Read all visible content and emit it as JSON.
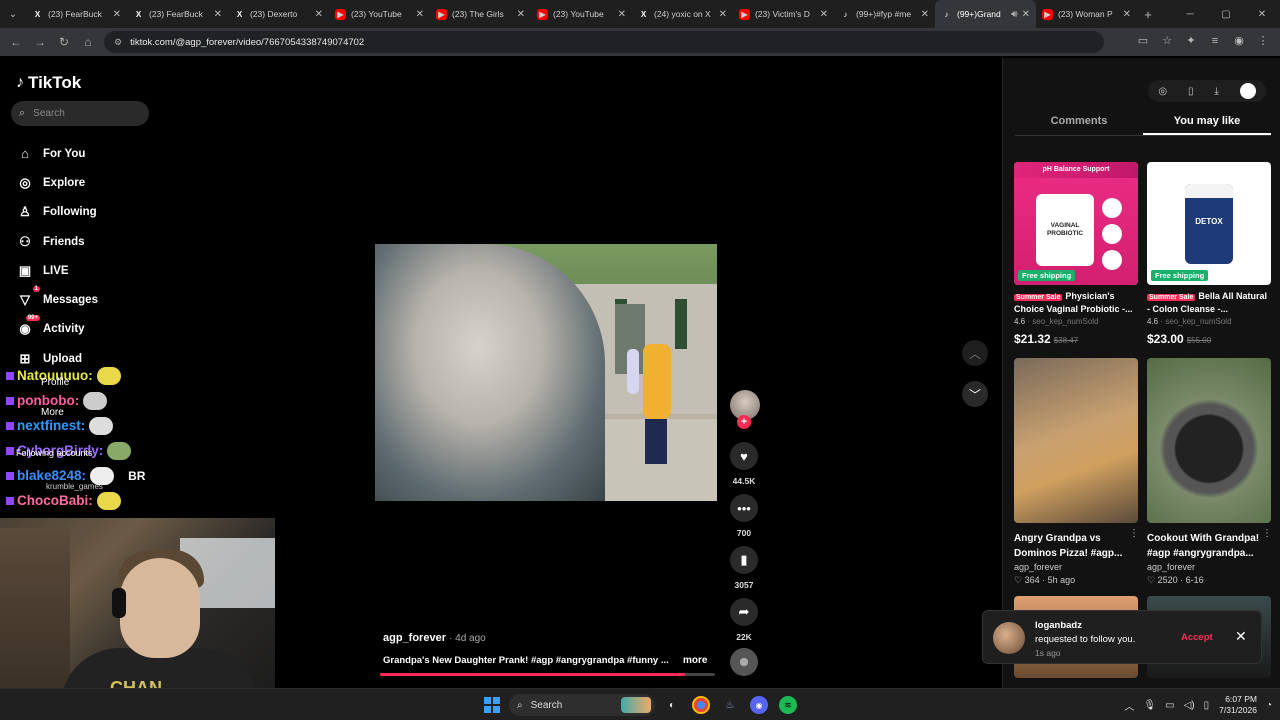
{
  "browser": {
    "tabs": [
      {
        "label": "(23) FearBuck",
        "icon": "x-icon"
      },
      {
        "label": "(23) FearBuck",
        "icon": "x-icon"
      },
      {
        "label": "(23) Dexerto",
        "icon": "x-icon"
      },
      {
        "label": "(23) YouTube",
        "icon": "youtube-icon"
      },
      {
        "label": "(23) The Girls",
        "icon": "youtube-icon"
      },
      {
        "label": "(23) YouTube",
        "icon": "youtube-icon"
      },
      {
        "label": "(24) yoxic on X",
        "icon": "x-icon"
      },
      {
        "label": "(23) Victim's D",
        "icon": "youtube-icon"
      },
      {
        "label": "(99+)#fyp #me",
        "icon": "tiktok-icon"
      },
      {
        "label": "(99+)Grand",
        "icon": "tiktok-icon",
        "active": true
      },
      {
        "label": "(23) Woman P",
        "icon": "youtube-icon"
      }
    ],
    "url": "tiktok.com/@agp_forever/video/7667054338749074702"
  },
  "sidebar": {
    "logo": "TikTok",
    "search_placeholder": "Search",
    "items": [
      {
        "label": "For You",
        "icon": "home-icon"
      },
      {
        "label": "Explore",
        "icon": "compass-icon"
      },
      {
        "label": "Following",
        "icon": "following-icon"
      },
      {
        "label": "Friends",
        "icon": "friends-icon"
      },
      {
        "label": "LIVE",
        "icon": "live-icon"
      },
      {
        "label": "Messages",
        "icon": "messages-icon",
        "badge": "1"
      },
      {
        "label": "Activity",
        "icon": "activity-icon",
        "badge": "99+"
      },
      {
        "label": "Upload",
        "icon": "upload-icon"
      }
    ],
    "hidden_labels": [
      "Profile",
      "More",
      "Following accounts",
      "krumble_games"
    ]
  },
  "chat": [
    {
      "user": "Natouuuuo:",
      "extra": ""
    },
    {
      "user": "ponbobo:",
      "extra": ""
    },
    {
      "user": "nextfinest:",
      "extra": ""
    },
    {
      "user": "CyborgBirdy:",
      "extra": ""
    },
    {
      "user": "blake8248:",
      "extra": "BR"
    },
    {
      "user": "ChocoBabi:",
      "extra": ""
    }
  ],
  "webcam": {
    "shirt_text": "CHAN"
  },
  "video": {
    "author": "agp_forever",
    "age": "· 4d ago",
    "caption": "Grandpa's New Daughter Prank! #agp #angrygrandpa #funny ...",
    "more": "more",
    "progress": 0.91,
    "likes": "44.5K",
    "comments": "700",
    "saves": "3057",
    "shares": "22K"
  },
  "right_panel": {
    "tabs": [
      {
        "label": "Comments",
        "active": false
      },
      {
        "label": "You may like",
        "active": true
      }
    ],
    "products": [
      {
        "banner": "pH Balance Support",
        "product_name": "VAGINAL PROBIOTIC",
        "free_shipping": "Free shipping",
        "sale": "Summer Sale",
        "title": "Physician's Choice Vaginal Probiotic -...",
        "rating": "4.6",
        "sold": "· seo_kep_numSold",
        "price": "$21.32",
        "old_price": "$38.47"
      },
      {
        "banner": "",
        "product_name": "DETOX",
        "free_shipping": "Free shipping",
        "sale": "Summer Sale",
        "title": "Bella All Natural - Colon Cleanse -...",
        "rating": "4.6",
        "sold": "· seo_kep_numSold",
        "price": "$23.00",
        "old_price": "$55.00"
      }
    ],
    "videos": [
      {
        "title": "Angry Grandpa vs Dominos Pizza! #agp...",
        "author": "agp_forever",
        "likes": "♡ 364",
        "age": "· 5h ago"
      },
      {
        "title": "Cookout With Grandpa! #agp #angrygrandpa...",
        "author": "agp_forever",
        "likes": "♡ 2520",
        "age": "· 6-16"
      }
    ]
  },
  "notification": {
    "user": "loganbadz",
    "text": "requested to follow you.",
    "time": "1s ago",
    "accept": "Accept"
  },
  "taskbar": {
    "search": "Search",
    "time": "6:07 PM",
    "date": "7/31/2026"
  },
  "colors": {
    "accent": "#fe2c55",
    "free_shipping": "#18b06a"
  }
}
